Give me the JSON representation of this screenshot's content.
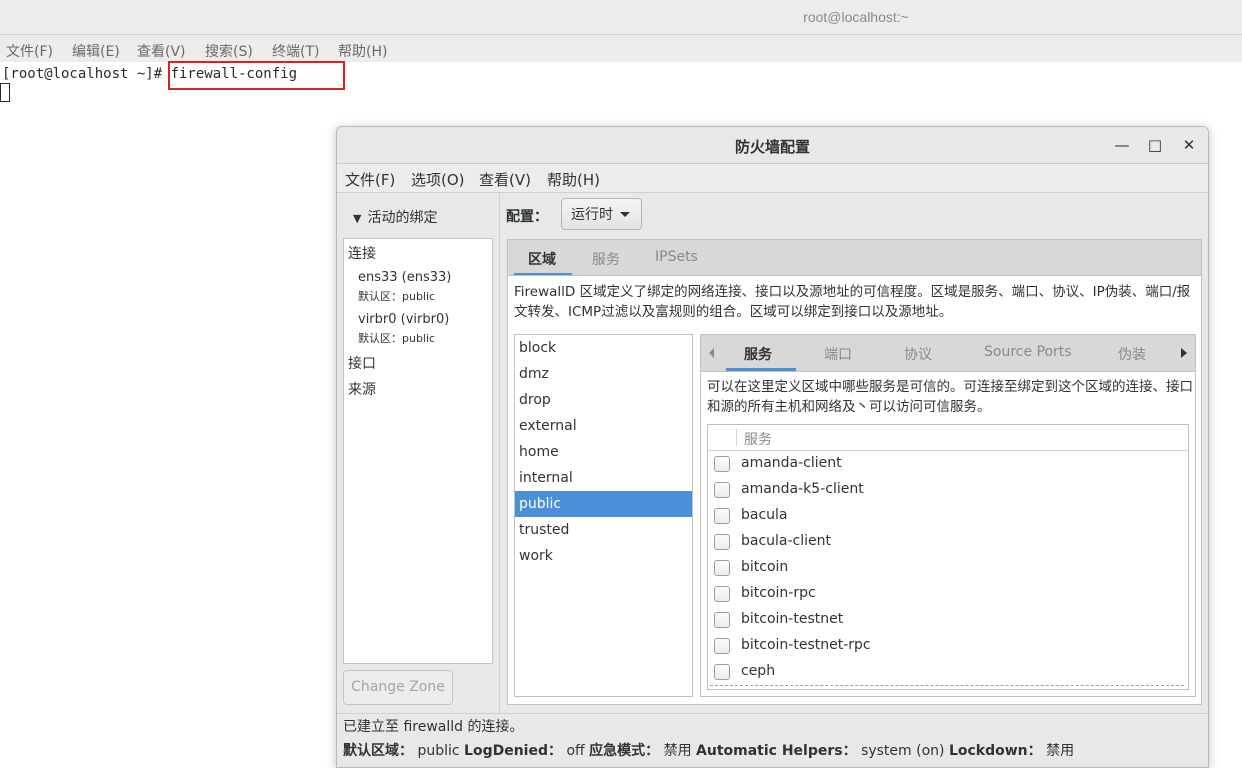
{
  "terminal": {
    "title": "root@localhost:~",
    "menu": [
      "文件(F)",
      "编辑(E)",
      "查看(V)",
      "搜索(S)",
      "终端(T)",
      "帮助(H)"
    ],
    "prompt": "[root@localhost ~]# ",
    "command": "firewall-config"
  },
  "firewall": {
    "title": "防火墙配置",
    "window_controls": {
      "minimize": "—",
      "maximize": "□",
      "close": "✕"
    },
    "menu": [
      "文件(F)",
      "选项(O)",
      "查看(V)",
      "帮助(H)"
    ],
    "binding": {
      "header": "活动的绑定",
      "connections_label": "连接",
      "connections": [
        {
          "iface": "ens33 (ens33)",
          "zone": "默认区：public"
        },
        {
          "iface": "virbr0 (virbr0)",
          "zone": "默认区：public"
        }
      ],
      "interfaces_label": "接口",
      "sources_label": "来源",
      "change_zone_button": "Change Zone"
    },
    "config_label": "配置：",
    "config_value": "运行时",
    "main_tabs": [
      "区域",
      "服务",
      "IPSets"
    ],
    "zone_description": "FirewallD 区域定义了绑定的网络连接、接口以及源地址的可信程度。区域是服务、端口、协议、IP伪装、端口/报文转发、ICMP过滤以及富规则的组合。区域可以绑定到接口以及源地址。",
    "zones": [
      "block",
      "dmz",
      "drop",
      "external",
      "home",
      "internal",
      "public",
      "trusted",
      "work"
    ],
    "selected_zone": "public",
    "sub_tabs": [
      "服务",
      "端口",
      "协议",
      "Source Ports",
      "伪装"
    ],
    "service_description": "可以在这里定义区域中哪些服务是可信的。可连接至绑定到这个区域的连接、接口和源的所有主机和网络及丶可以访问可信服务。",
    "service_column": "服务",
    "services": [
      "amanda-client",
      "amanda-k5-client",
      "bacula",
      "bacula-client",
      "bitcoin",
      "bitcoin-rpc",
      "bitcoin-testnet",
      "bitcoin-testnet-rpc",
      "ceph"
    ],
    "status": {
      "connection": "已建立至 firewalld 的连接。",
      "default_zone_label": "默认区域：",
      "default_zone": "public",
      "log_denied_label": "LogDenied：",
      "log_denied": "off",
      "panic_label": "应急模式：",
      "panic": "禁用",
      "auto_helpers_label": "Automatic Helpers：",
      "auto_helpers": "system (on)",
      "lockdown_label": "Lockdown：",
      "lockdown": "禁用"
    }
  },
  "colors": {
    "accent": "#4a90d9",
    "highlight_box": "#e02020"
  }
}
